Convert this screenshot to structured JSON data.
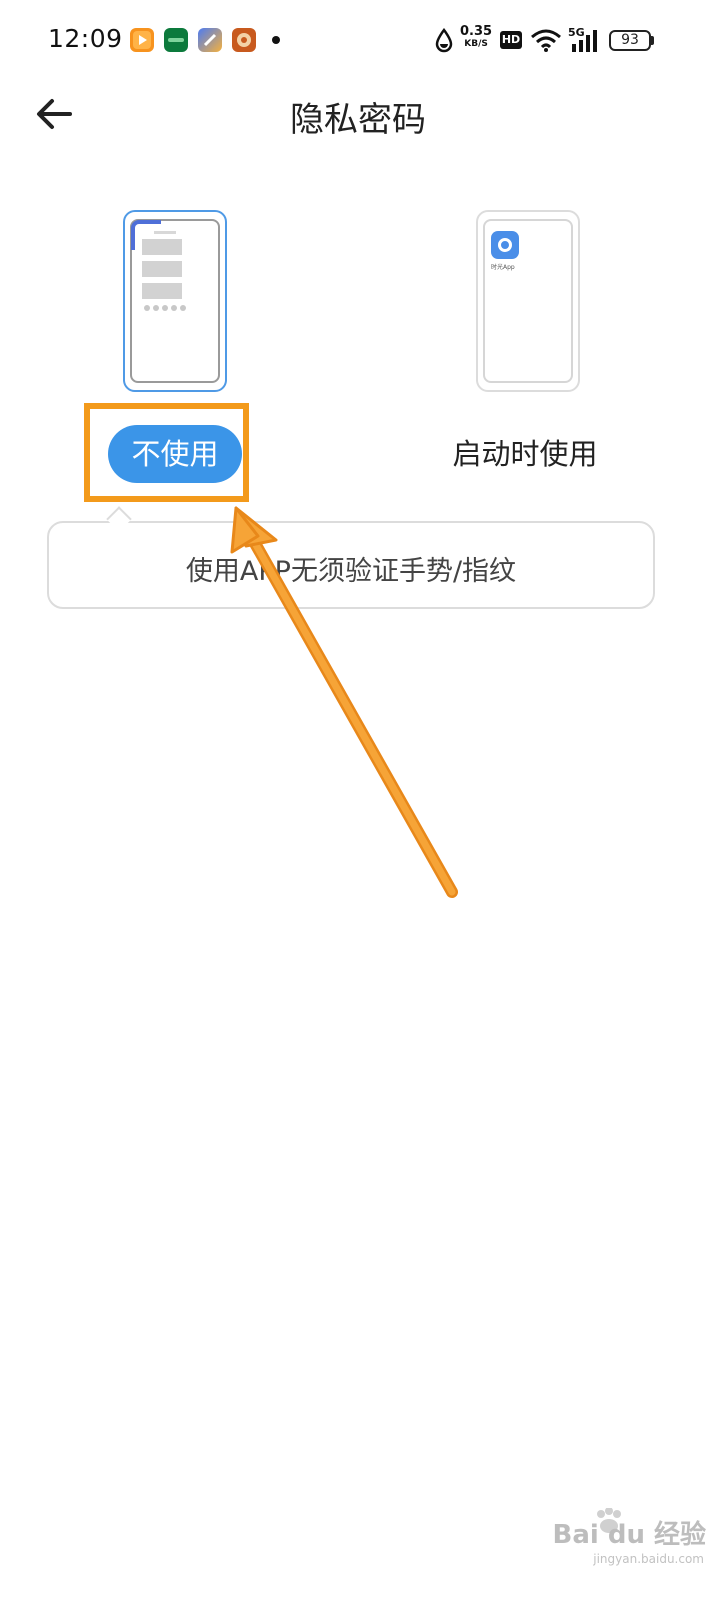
{
  "status_bar": {
    "time": "12:09",
    "speed_value": "0.35",
    "speed_unit": "KB/S",
    "hd_label": "HD",
    "network_label": "5G",
    "battery": "93"
  },
  "header": {
    "title": "隐私密码"
  },
  "options": {
    "off_label": "不使用",
    "on_label": "启动时使用",
    "selected": "off"
  },
  "preview_right": {
    "app_label": "时光App"
  },
  "tooltip": {
    "text": "使用APP无须验证手势/指纹"
  },
  "watermark": {
    "brand": "Bai du 经验",
    "url": "jingyan.baidu.com"
  },
  "colors": {
    "accent": "#3b95e8",
    "annotation": "#f39a1b"
  },
  "icons": {
    "back": "arrow-left-icon",
    "wifi": "wifi-icon",
    "signal": "signal-icon",
    "battery": "battery-icon",
    "drop": "data-saver-icon"
  }
}
